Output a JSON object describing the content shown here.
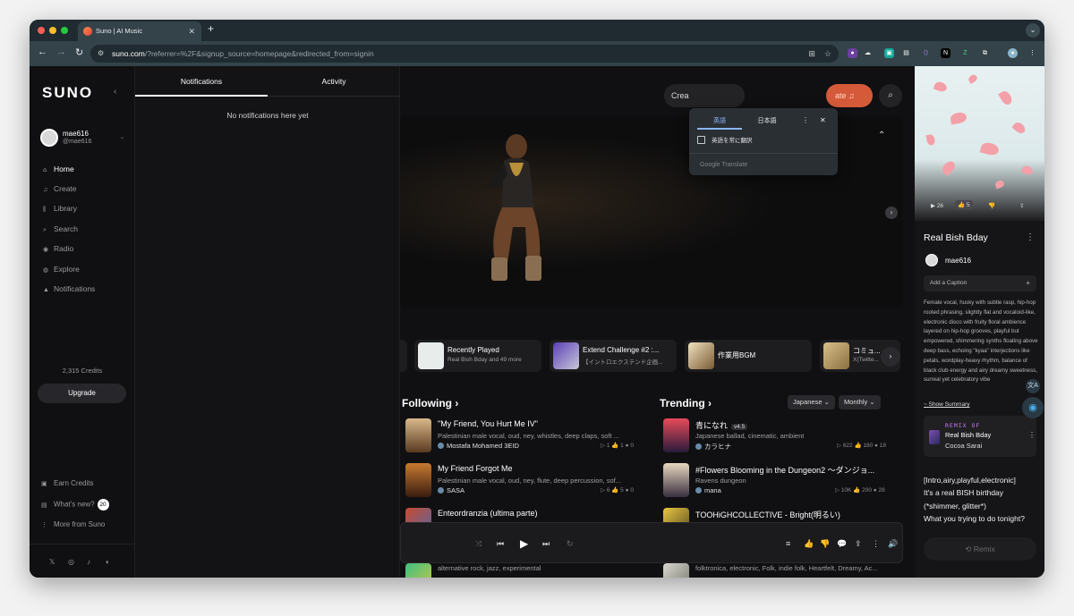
{
  "browser": {
    "tab_title": "Suno | AI Music",
    "url_host": "suno.com",
    "url_rest": "/?referrer=%2F&signup_source=homepage&redirected_from=signin",
    "colors": {
      "close": "#ff5f57",
      "minimize": "#febc2e",
      "zoom": "#28c840"
    }
  },
  "translate_popup": {
    "tab_source": "英語",
    "tab_target": "日本語",
    "always_translate": "英語を常に翻訳",
    "footer": "Google Translate"
  },
  "sidebar": {
    "logo": "SUNO",
    "user": {
      "name": "mae616",
      "handle": "@mae616"
    },
    "nav": [
      {
        "label": "Home",
        "icon": "home-icon"
      },
      {
        "label": "Create",
        "icon": "music-note-icon"
      },
      {
        "label": "Library",
        "icon": "library-icon"
      },
      {
        "label": "Search",
        "icon": "search-icon"
      },
      {
        "label": "Radio",
        "icon": "radio-icon"
      },
      {
        "label": "Explore",
        "icon": "compass-icon"
      },
      {
        "label": "Notifications",
        "icon": "bell-icon"
      }
    ],
    "credits": "2,315 Credits",
    "upgrade": "Upgrade",
    "earn_credits": "Earn Credits",
    "whats_new": "What's new?",
    "whats_new_count": "20",
    "more_from_suno": "More from Suno"
  },
  "notifications": {
    "tab_notifications": "Notifications",
    "tab_activity": "Activity",
    "empty": "No notifications here yet"
  },
  "main": {
    "search_partial": "Crea",
    "create_partial": "ate",
    "playlists": [
      {
        "title": "Recently Played",
        "sub": "Real Bish Bday and 49 more"
      },
      {
        "title": "Extend Challenge #2 :...",
        "sub": "【イントロエクステンド企画..."
      },
      {
        "title": "作業用BGM",
        "sub": ""
      },
      {
        "title": "コミュ...",
        "sub": "X(Twitte..."
      }
    ],
    "following_title": "Following",
    "trending_title": "Trending",
    "language_filter": "Japanese",
    "period_filter": "Monthly",
    "following": [
      {
        "title": "\"My Friend, You Hurt Me IV\"",
        "desc": "Palestinian male vocal, oud, ney, whistles, deep claps, soft ...",
        "artist": "Mostafa Mohamed 3EID",
        "plays": "1",
        "likes": "1",
        "comments": "0"
      },
      {
        "title": "My Friend Forgot Me",
        "desc": "Palestinian male vocal, oud, ney, flute, deep percussion, sof...",
        "artist": "SASA",
        "plays": "6",
        "likes": "5",
        "comments": "0"
      },
      {
        "title": "Enteordranzia (ultima parte)",
        "desc": "",
        "artist": ""
      },
      {
        "title": "",
        "desc": "alternative rock, jazz, experimental",
        "artist": ""
      }
    ],
    "trending": [
      {
        "title": "青になれ",
        "version": "v4.5",
        "desc": "Japanese ballad, cinematic, ambient",
        "artist": "カラヒナ",
        "plays": "622",
        "likes": "180",
        "comments": "18"
      },
      {
        "title": "#Flowers Blooming in the Dungeon2 〜ダンジョ...",
        "version": "",
        "desc": "Ravens dungeon",
        "artist": "mana",
        "plays": "10K",
        "likes": "200",
        "comments": "28"
      },
      {
        "title": "TOOHiGHCOLLECTIVE - Bright(明るい)",
        "version": "",
        "desc": "",
        "artist": ""
      },
      {
        "title": "",
        "version": "",
        "desc": "folktronica, electronic, Folk, indie folk, Heartfelt, Dreamy, Ac...",
        "artist": ""
      }
    ]
  },
  "detail": {
    "plays": "26",
    "likes": "5",
    "title": "Real Bish Bday",
    "user": "mae616",
    "caption_placeholder": "Add a Caption",
    "description": "Female vocal, husky with subtle rasp, hip-hop rooted phrasing, slightly flat and vocaloid-like, electronic disco with fruity floral ambience layered on hip-hop grooves, playful but empowered, shimmering synths floating above deep bass, echoing \"kyaa\" interjections like petals, wordplay-heavy rhythm, balance of black club energy and airy dreamy sweetness, surreal yet celebratory vibe",
    "show_summary": "Show Summary",
    "remix_of_label": "REMIX OF",
    "remix_title": "Real Bish Bday",
    "remix_user": "Cocoa Sarai",
    "lyrics": [
      "[Intro,airy,playful,electronic]",
      "It's a real BISH birthday",
      "(*shimmer, glitter*)",
      "What you trying to do tonight?"
    ],
    "remix_button": "Remix"
  }
}
